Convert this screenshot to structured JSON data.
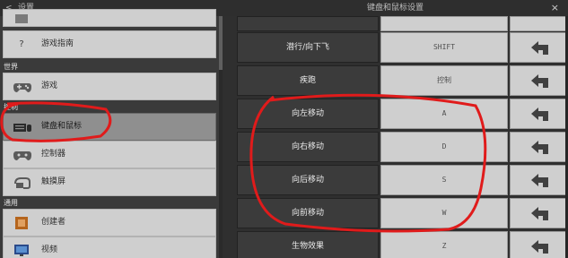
{
  "header": {
    "back_label": "<",
    "title": "设置",
    "panel_title": "键盘和鼠标设置",
    "close_label": "×"
  },
  "sidebar": {
    "items": [
      {
        "label": "游戏指南",
        "icon": "question-icon"
      },
      {
        "label": "游戏",
        "icon": "gamepad-icon"
      },
      {
        "label": "键盘和鼠标",
        "icon": "keyboard-mouse-icon",
        "active": true
      },
      {
        "label": "控制器",
        "icon": "controller-icon"
      },
      {
        "label": "触摸屏",
        "icon": "touch-icon"
      },
      {
        "label": "创建者",
        "icon": "creator-icon"
      },
      {
        "label": "视频",
        "icon": "monitor-icon"
      }
    ],
    "sections": {
      "world": "世界",
      "controls": "控制",
      "general": "通用"
    },
    "question_glyph": "?"
  },
  "bindings": [
    {
      "action": "潜行/向下飞",
      "key": "SHIFT"
    },
    {
      "action": "疾跑",
      "key": "控制"
    },
    {
      "action": "向左移动",
      "key": "A"
    },
    {
      "action": "向右移动",
      "key": "D"
    },
    {
      "action": "向后移动",
      "key": "S"
    },
    {
      "action": "向前移动",
      "key": "W"
    },
    {
      "action": "生物效果",
      "key": "Z"
    }
  ],
  "colors": {
    "annotation": "#e01b1b",
    "sidebar_item": "#cfcfcf",
    "sidebar_active": "#8f8f8f",
    "action_cell": "#3b3b3b"
  }
}
